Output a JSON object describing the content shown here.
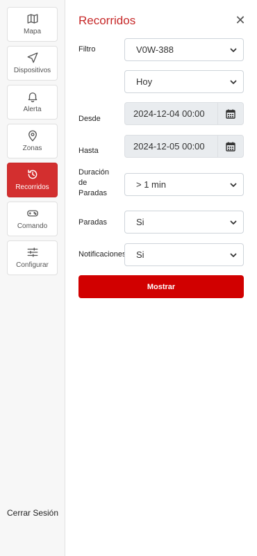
{
  "colors": {
    "accent": "#d10000",
    "title": "#c62828",
    "active_nav_bg": "#d32f2f"
  },
  "sidebar": {
    "items": [
      {
        "label": "Mapa",
        "icon": "map-icon",
        "active": false
      },
      {
        "label": "Dispositivos",
        "icon": "navigation-icon",
        "active": false
      },
      {
        "label": "Alerta",
        "icon": "bell-icon",
        "active": false
      },
      {
        "label": "Zonas",
        "icon": "location-pin-icon",
        "active": false
      },
      {
        "label": "Recorridos",
        "icon": "history-icon",
        "active": true
      },
      {
        "label": "Comando",
        "icon": "gamepad-icon",
        "active": false
      },
      {
        "label": "Configurar",
        "icon": "sliders-icon",
        "active": false
      }
    ],
    "logout_label": "Cerrar Sesión"
  },
  "panel": {
    "title": "Recorridos",
    "close_icon": "close-icon",
    "filter": {
      "label": "Filtro",
      "device_value": "V0W-388",
      "period_value": "Hoy"
    },
    "from": {
      "label": "Desde",
      "value": "2024-12-04 00:00"
    },
    "to": {
      "label": "Hasta",
      "value": "2024-12-05 00:00"
    },
    "stop_duration": {
      "label_line1": "Duración",
      "label_line2": "de",
      "label_line3": "Paradas",
      "value": "> 1 min"
    },
    "stops": {
      "label": "Paradas",
      "value": "Si"
    },
    "notifications": {
      "label": "Notificaciones",
      "value": "Si"
    },
    "submit_label": "Mostrar"
  }
}
